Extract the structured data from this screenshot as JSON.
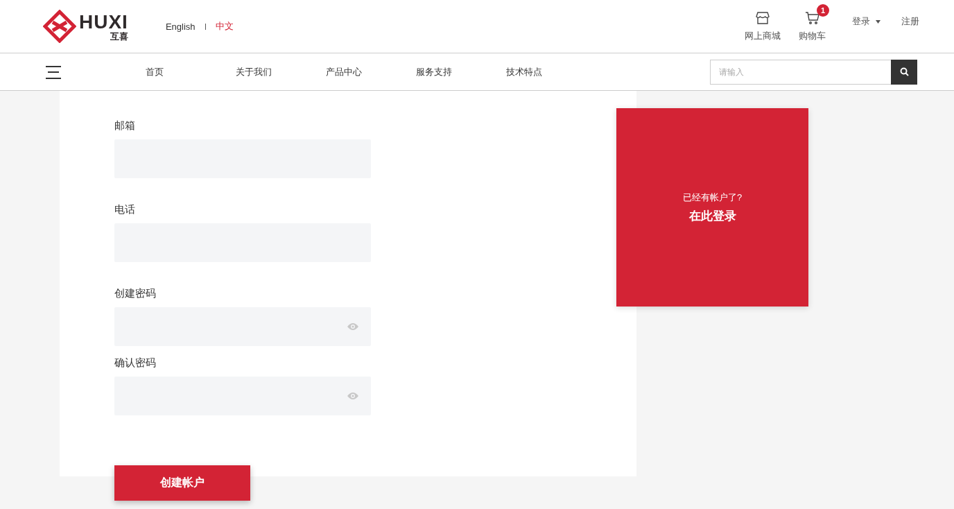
{
  "header": {
    "logo": {
      "wordmark": "HUXI",
      "subtitle": "互喜"
    },
    "languages": [
      {
        "label": "English",
        "selected": false
      },
      {
        "label": "中文",
        "selected": true
      }
    ],
    "shop": {
      "label": "网上商城"
    },
    "cart": {
      "label": "购物车",
      "badge": "1"
    },
    "login": {
      "label": "登录"
    },
    "register": {
      "label": "注册"
    }
  },
  "nav": {
    "items": [
      "首页",
      "关于我们",
      "产品中心",
      "服务支持",
      "技术特点"
    ],
    "search": {
      "placeholder": "请输入"
    }
  },
  "form": {
    "fields": [
      {
        "label": "邮箱",
        "kind": "text"
      },
      {
        "label": "电话",
        "kind": "text"
      },
      {
        "label": "创建密码",
        "kind": "password"
      },
      {
        "label": "确认密码",
        "kind": "password"
      }
    ],
    "submit": "创建帐户"
  },
  "login_panel": {
    "question": "已经有帐户了?",
    "link": "在此登录"
  }
}
